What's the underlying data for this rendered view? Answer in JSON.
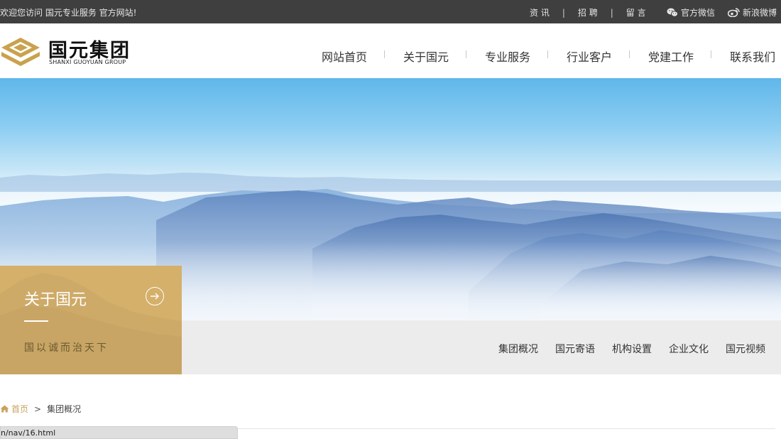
{
  "topbar": {
    "welcome": "欢迎您访问 国元专业服务 官方网站!",
    "links": [
      "资 讯",
      "招 聘",
      "留 言"
    ],
    "separator": "|",
    "wechat": "官方微信",
    "weibo": "新浪微博"
  },
  "logo": {
    "cn": "国元集团",
    "en": "SHANXI GUOYUAN GROUP"
  },
  "nav": {
    "items": [
      "网站首页",
      "关于国元",
      "专业服务",
      "行业客户",
      "党建工作",
      "联系我们"
    ]
  },
  "section": {
    "title": "关于国元",
    "slogan": "国以诚而治天下"
  },
  "subnav": {
    "items": [
      "集团概况",
      "国元寄语",
      "机构设置",
      "企业文化",
      "国元视频"
    ]
  },
  "breadcrumb": {
    "home": "首页",
    "separator": ">",
    "current": "集团概况"
  },
  "statusbar": {
    "url": "n/nav/16.html"
  },
  "colors": {
    "topbar_bg": "#3f3f3f",
    "accent_gold": "#d4b06a",
    "subband_bg": "#ececec"
  }
}
